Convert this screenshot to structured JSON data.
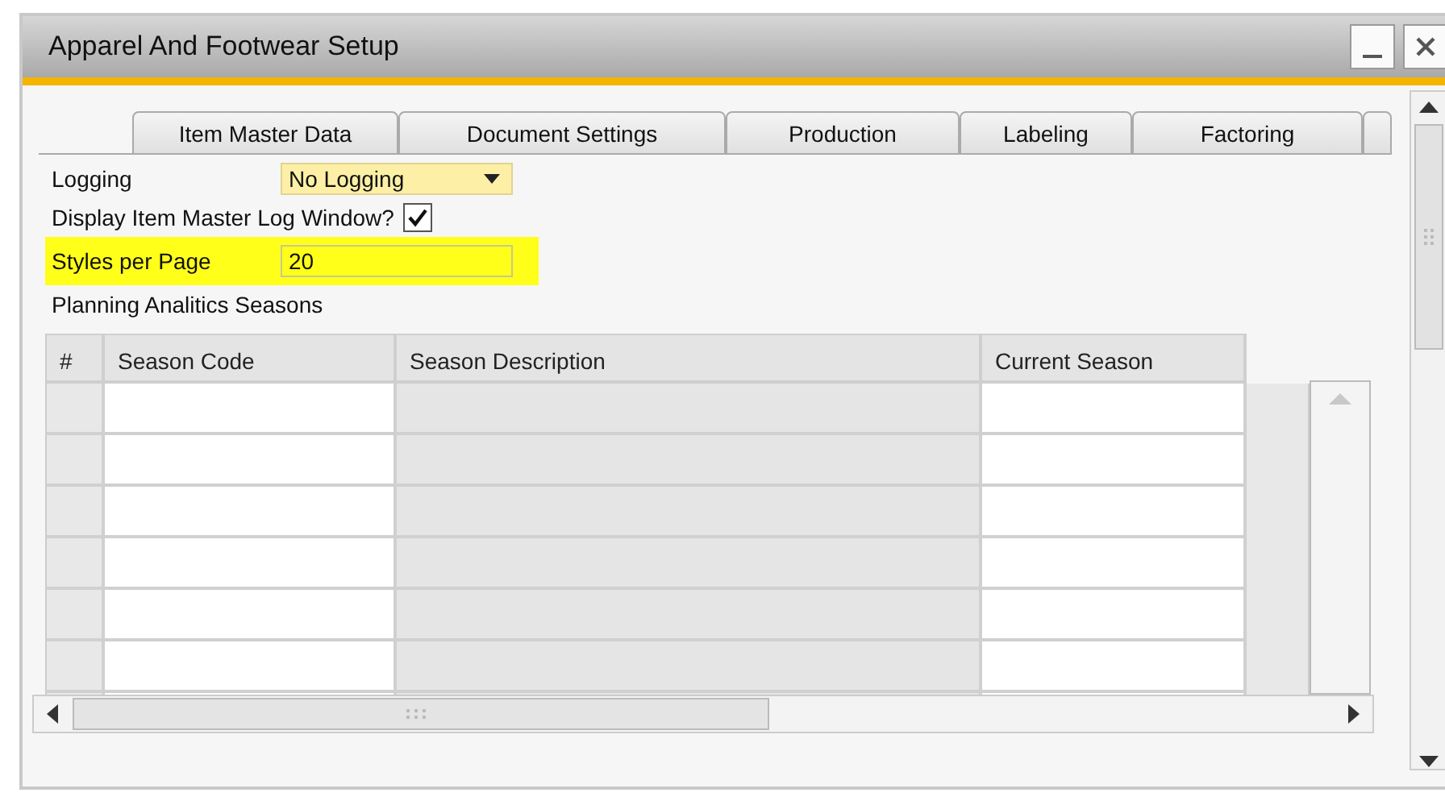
{
  "window": {
    "title": "Apparel And Footwear Setup"
  },
  "tabs": [
    {
      "label": "Item Master Data"
    },
    {
      "label": "Document Settings"
    },
    {
      "label": "Production"
    },
    {
      "label": "Labeling"
    },
    {
      "label": "Factoring"
    }
  ],
  "fields": [
    {
      "kind": "dropdown",
      "label": "Logging",
      "value": "No Logging"
    },
    {
      "kind": "checkbox",
      "label": "Display Item Master Log Window?",
      "checked": true
    },
    {
      "kind": "text",
      "label": "Styles per Page",
      "value": "20",
      "highlighted": true
    }
  ],
  "section_label": "Planning Analitics Seasons",
  "table": {
    "columns": [
      {
        "label": "#",
        "editable": false
      },
      {
        "label": "Season Code",
        "editable": true
      },
      {
        "label": "Season Description",
        "editable": false
      },
      {
        "label": "Current Season",
        "editable": true
      }
    ],
    "rows": [
      {
        "kind": "empty"
      },
      {
        "kind": "empty"
      },
      {
        "kind": "empty"
      },
      {
        "kind": "empty"
      },
      {
        "kind": "empty"
      },
      {
        "kind": "empty"
      },
      {
        "kind": "empty"
      }
    ]
  }
}
